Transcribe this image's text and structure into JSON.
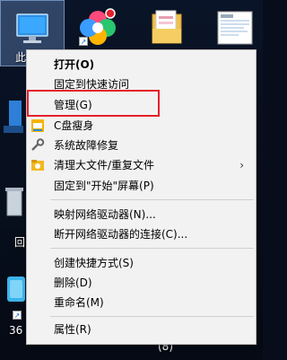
{
  "desktop": {
    "this_pc_label": "此",
    "left_label_1": "回",
    "left_label_2": "36",
    "bottom_number": "(8)"
  },
  "menu": {
    "items": [
      {
        "label": "打开(O)",
        "bold": true
      },
      {
        "label": "固定到快速访问"
      },
      {
        "label": "管理(G)"
      },
      {
        "label": "C盘瘦身",
        "icon": "c-drive-slim-icon"
      },
      {
        "label": "系统故障修复",
        "icon": "wrench-icon"
      },
      {
        "label": "清理大文件/重复文件",
        "icon": "folder-clean-icon",
        "submenu": true
      },
      {
        "label": "固定到\"开始\"屏幕(P)"
      },
      {
        "label": "映射网络驱动器(N)..."
      },
      {
        "label": "断开网络驱动器的连接(C)..."
      },
      {
        "label": "创建快捷方式(S)"
      },
      {
        "label": "删除(D)"
      },
      {
        "label": "重命名(M)"
      },
      {
        "label": "属性(R)"
      }
    ],
    "submenu_arrow": "›"
  },
  "colors": {
    "menu_bg": "#f2f2f2",
    "highlight_box": "#e5202a",
    "desktop_bg": "#070d1a"
  }
}
